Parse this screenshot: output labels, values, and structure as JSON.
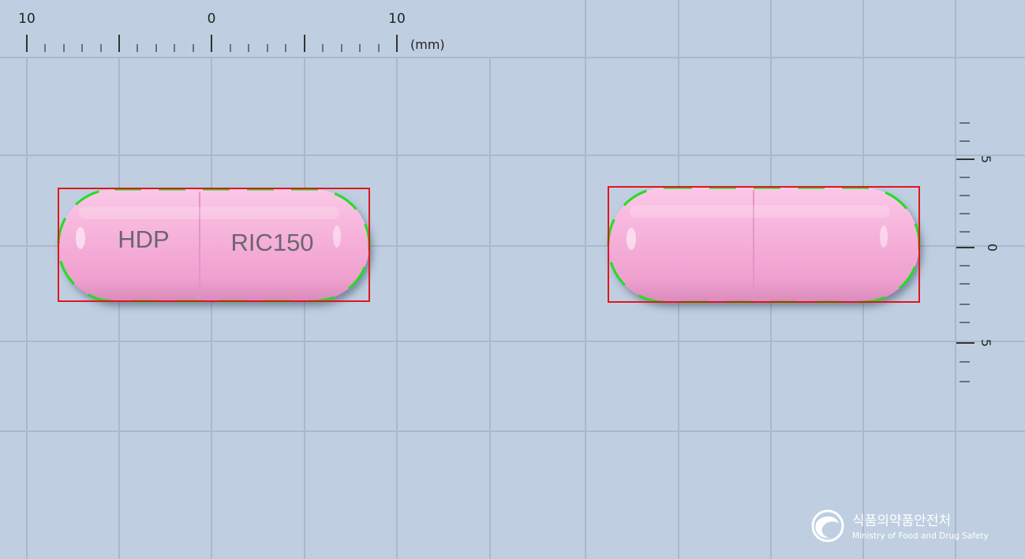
{
  "top_ruler": {
    "labels": [
      "10",
      "0",
      "10"
    ],
    "unit": "(mm)"
  },
  "side_ruler": {
    "labels": [
      "5",
      "0",
      "5"
    ]
  },
  "capsule_front": {
    "imprint_left": "HDP",
    "imprint_right": "RIC150"
  },
  "capsule_back": {},
  "logo": {
    "korean": "식품의약품안전처",
    "english": "Ministry of Food and Drug Safety"
  },
  "colors": {
    "background": "#bfcfe1",
    "grid": "#a9b8ca",
    "capsule": "#f4a9d6",
    "bounding_box": "#e0161c",
    "contour": "#22dd22"
  }
}
